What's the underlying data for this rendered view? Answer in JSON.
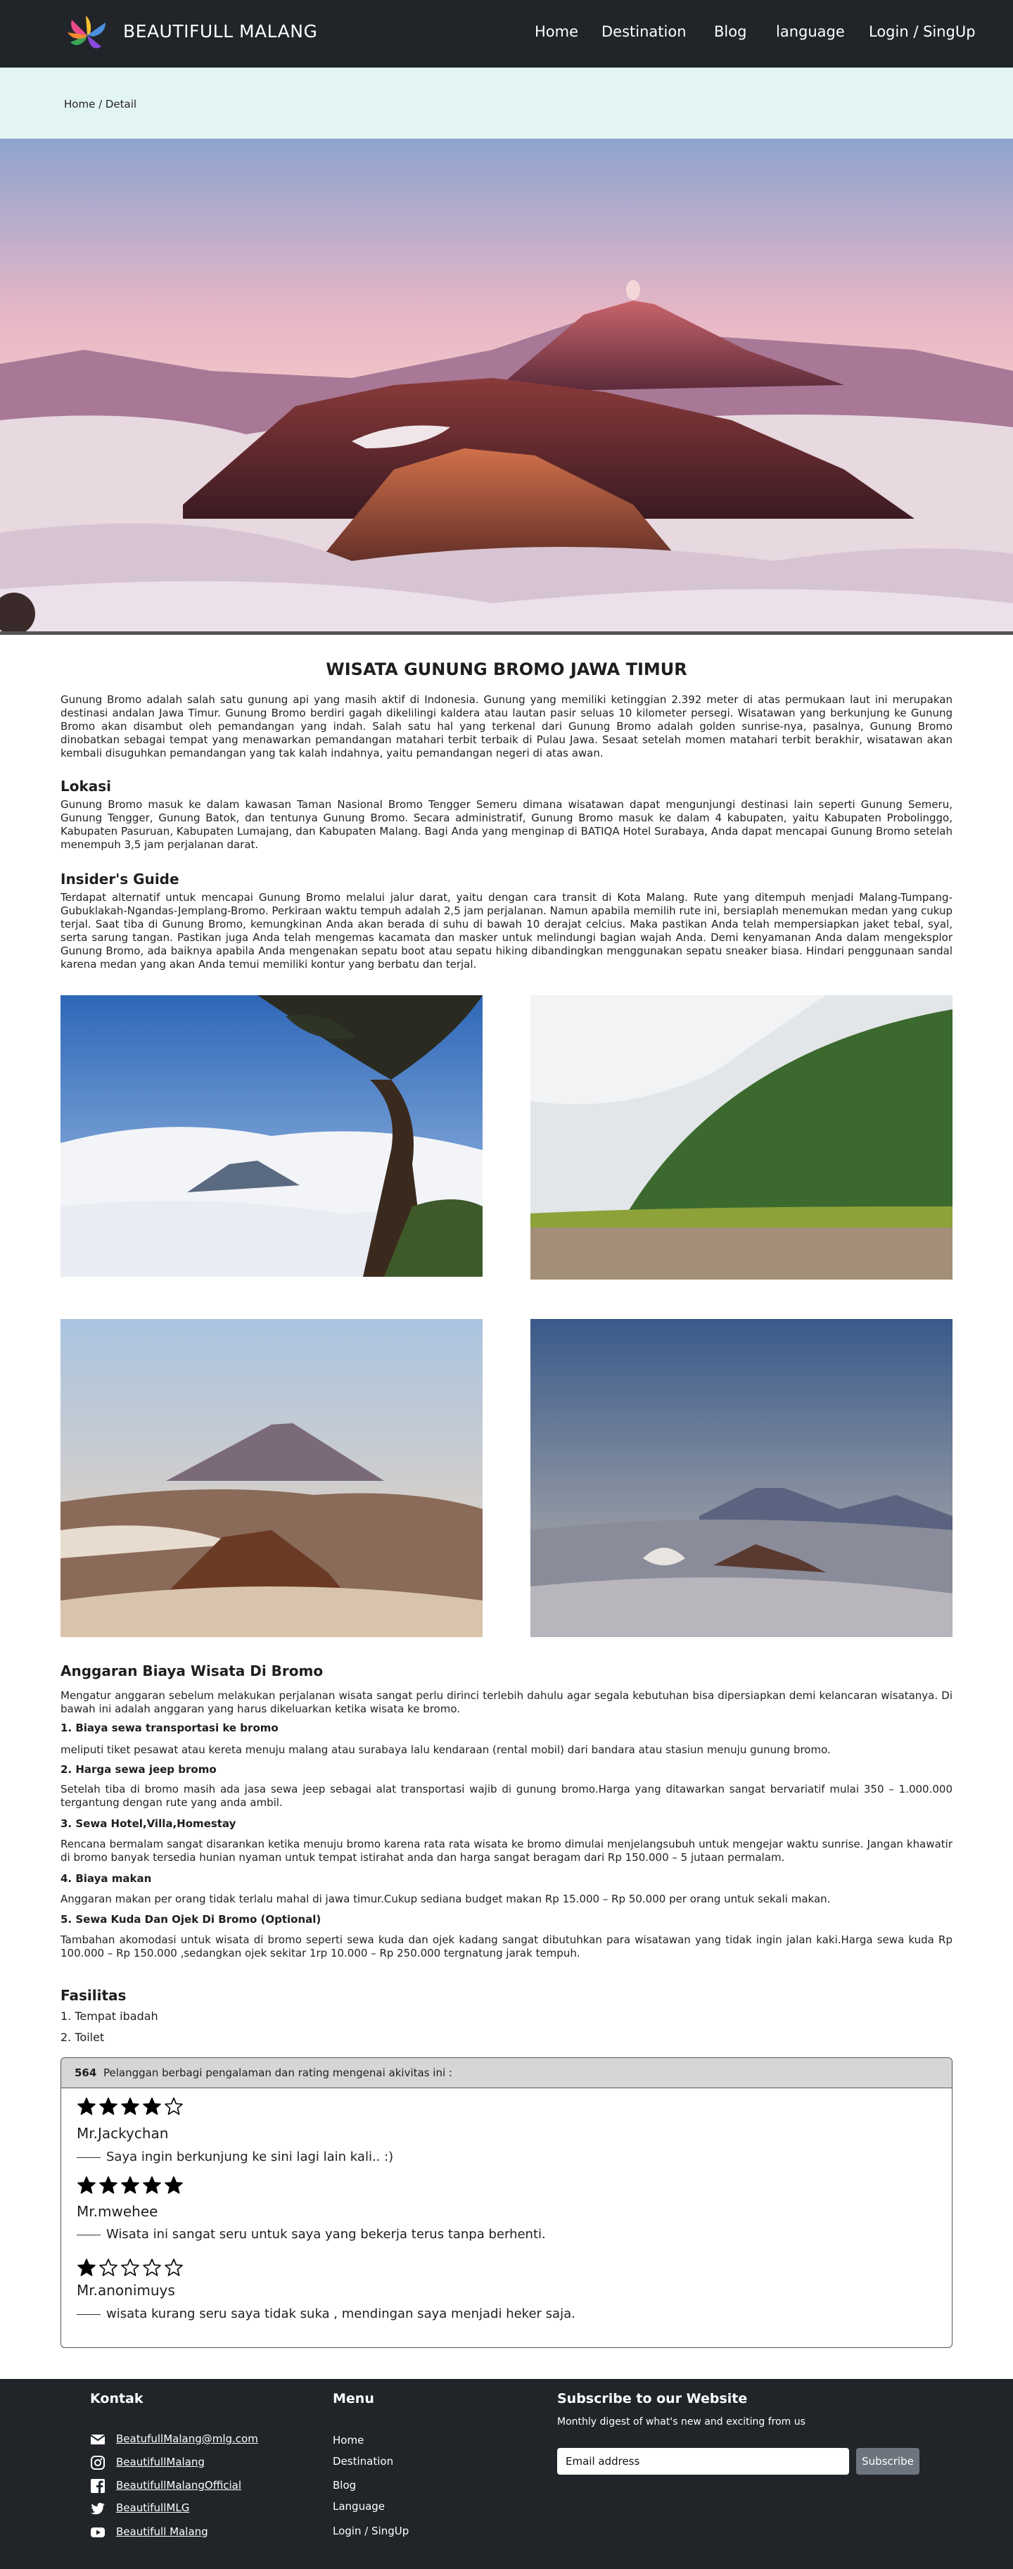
{
  "nav": {
    "brand": "BEAUTIFULL MALANG",
    "links": [
      "Home",
      "Destination",
      "Blog",
      "language",
      "Login / SingUp"
    ]
  },
  "breadcrumb": "Home / Detail",
  "article": {
    "title": "WISATA GUNUNG BROMO JAWA TIMUR",
    "intro": "Gunung Bromo adalah salah satu gunung api yang masih aktif di Indonesia. Gunung yang memiliki ketinggian 2.392 meter di atas permukaan laut ini merupakan destinasi andalan Jawa Timur. Gunung Bromo berdiri gagah dikelilingi kaldera atau lautan pasir seluas 10 kilometer persegi. Wisatawan yang berkunjung ke Gunung Bromo akan disambut oleh pemandangan yang indah. Salah satu hal yang terkenal dari Gunung Bromo adalah golden sunrise-nya, pasalnya, Gunung Bromo dinobatkan sebagai tempat yang menawarkan pemandangan matahari terbit terbaik di Pulau Jawa. Sesaat setelah momen matahari terbit berakhir, wisatawan akan kembali disuguhkan pemandangan yang tak kalah indahnya, yaitu pemandangan negeri di atas awan.",
    "lokasi_heading": "Lokasi",
    "lokasi_text": "Gunung Bromo masuk ke dalam kawasan Taman Nasional Bromo Tengger Semeru dimana wisatawan dapat mengunjungi destinasi lain seperti Gunung Semeru, Gunung Tengger, Gunung Batok, dan tentunya Gunung Bromo. Secara administratif, Gunung Bromo masuk ke dalam 4 kabupaten, yaitu Kabupaten Probolinggo, Kabupaten Pasuruan, Kabupaten Lumajang, dan Kabupaten Malang. Bagi Anda yang menginap di BATIQA Hotel Surabaya, Anda dapat mencapai Gunung Bromo setelah menempuh 3,5 jam perjalanan darat.",
    "guide_heading": "Insider's Guide",
    "guide_text": "Terdapat alternatif untuk mencapai Gunung Bromo melalui jalur darat, yaitu dengan cara transit di Kota Malang. Rute yang ditempuh menjadi Malang-Tumpang-Gubuklakah-Ngandas-Jemplang-Bromo. Perkiraan waktu tempuh adalah 2,5 jam perjalanan. Namun apabila memilih rute ini, bersiaplah menemukan medan yang cukup terjal. Saat tiba di Gunung Bromo, kemungkinan Anda akan berada di suhu di bawah 10 derajat celcius. Maka pastikan Anda telah mempersiapkan jaket tebal, syal, serta sarung tangan. Pastikan juga Anda telah mengemas kacamata dan masker untuk melindungi bagian wajah Anda. Demi kenyamanan Anda dalam mengeksplor Gunung Bromo, ada baiknya apabila Anda mengenakan sepatu boot atau sepatu hiking dibandingkan menggunakan sepatu sneaker biasa. Hindari penggunaan sandal karena medan yang akan Anda temui memiliki kontur yang berbatu dan terjal.",
    "budget_heading": "Anggaran Biaya Wisata Di Bromo",
    "budget_intro": "Mengatur anggaran sebelum melakukan perjalanan wisata sangat perlu dirinci terlebih dahulu agar segala kebutuhan bisa dipersiapkan demi kelancaran wisatanya. Di bawah ini adalah anggaran yang harus dikeluarkan ketika wisata ke bromo.",
    "budget_items": [
      {
        "title": "1. Biaya sewa transportasi ke bromo",
        "text": "meliputi tiket pesawat atau kereta menuju malang atau surabaya lalu kendaraan (rental mobil) dari bandara atau stasiun menuju gunung bromo."
      },
      {
        "title": "2. Harga sewa jeep bromo",
        "text": "Setelah tiba di bromo masih ada jasa sewa jeep sebagai alat transportasi wajib di gunung bromo.Harga yang ditawarkan sangat bervariatif mulai 350 – 1.000.000 tergantung dengan rute yang anda ambil."
      },
      {
        "title": "3. Sewa Hotel,Villa,Homestay",
        "text": "Rencana bermalam sangat disarankan ketika menuju bromo karena rata rata wisata ke bromo dimulai menjelangsubuh untuk mengejar waktu sunrise. Jangan khawatir di bromo banyak tersedia hunian nyaman untuk tempat istirahat anda dan harga sangat beragam dari Rp 150.000 – 5 jutaan permalam."
      },
      {
        "title": "4. Biaya makan",
        "text": "Anggaran makan per orang tidak terlalu mahal di jawa timur.Cukup sediana budget makan Rp 15.000 – Rp 50.000 per orang untuk sekali makan."
      },
      {
        "title": "5. Sewa Kuda Dan Ojek Di Bromo (Optional)",
        "text": "Tambahan akomodasi untuk wisata di bromo seperti sewa kuda dan ojek kadang sangat dibutuhkan para wisatawan yang tidak ingin jalan kaki.Harga sewa kuda Rp 100.000 – Rp 150.000 ,sedangkan ojek sekitar 1rp 10.000 – Rp 250.000 tergnatung jarak tempuh."
      }
    ],
    "facilities_heading": "Fasilitas",
    "facilities": [
      "1. Tempat ibadah",
      "2. Toilet"
    ]
  },
  "reviews": {
    "count": "564",
    "heading": "Pelanggan berbagi pengalaman dan rating mengenai akivitas ini :",
    "items": [
      {
        "name": "Mr.Jackychan",
        "rating": 4,
        "text": "Saya ingin berkunjung ke sini lagi lain kali.. :)"
      },
      {
        "name": "Mr.mwehee",
        "rating": 5,
        "text": "Wisata ini sangat seru untuk saya yang bekerja terus tanpa berhenti."
      },
      {
        "name": "Mr.anonimuys",
        "rating": 1,
        "text": "wisata kurang seru saya tidak suka , mendingan saya menjadi heker saja."
      }
    ]
  },
  "footer": {
    "contact_heading": "Kontak",
    "contacts": [
      {
        "icon": "mail-icon",
        "label": "BeatufullMalang@mlg.com"
      },
      {
        "icon": "instagram-icon",
        "label": "BeautifullMalang"
      },
      {
        "icon": "facebook-icon",
        "label": "BeautifullMalangOfficial"
      },
      {
        "icon": "twitter-icon",
        "label": "BeautifullMLG"
      },
      {
        "icon": "youtube-icon",
        "label": "Beautifull Malang"
      }
    ],
    "menu_heading": "Menu",
    "menu": [
      "Home",
      "Destination",
      "Blog",
      "Language",
      "Login / SingUp"
    ],
    "subscribe_heading": "Subscribe to our Website",
    "subscribe_text": "Monthly digest of what's new and exciting from us",
    "email_placeholder": "Email address",
    "subscribe_button": "Subscribe"
  },
  "colors": {
    "navbar": "#212529",
    "breadcrumb_band": "#e3f5f2",
    "subscribe_button": "#6c757d"
  }
}
